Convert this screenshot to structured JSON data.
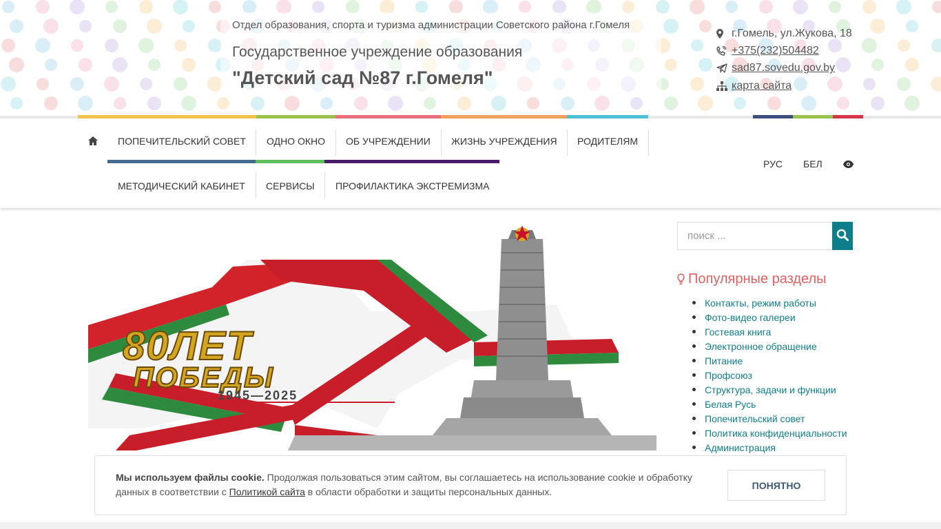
{
  "header": {
    "org_line": "Отдел образования, спорта и туризма администрации Советского района г.Гомеля",
    "institution_type": "Государственное учреждение образования",
    "institution_name": "\"Детский сад №87 г.Гомеля\"",
    "contacts": {
      "address": "г.Гомель, ул.Жукова, 18",
      "phone": "+375(232)504482",
      "website": "sad87.sovedu.gov.by",
      "sitemap": "карта сайта"
    }
  },
  "nav": {
    "home_icon": "home-icon",
    "items": [
      "ПОПЕЧИТЕЛЬСКИЙ СОВЕТ",
      "ОДНО ОКНО",
      "ОБ УЧРЕЖДЕНИИ",
      "ЖИЗНЬ УЧРЕЖДЕНИЯ",
      "РОДИТЕЛЯМ",
      "МЕТОДИЧЕСКИЙ КАБИНЕТ",
      "СЕРВИСЫ",
      "ПРОФИЛАКТИКА ЭКСТРЕМИЗМА"
    ],
    "lang_ru": "РУС",
    "lang_be": "БЕЛ",
    "accessibility_icon": "eye-icon"
  },
  "banner": {
    "line1": "80ЛЕТ",
    "line2": "ПОБЕДЫ",
    "years": "1945—2025"
  },
  "sidebar": {
    "search_placeholder": "поиск ...",
    "popular_title": "Популярные разделы",
    "popular_links": [
      "Контакты, режим работы",
      "Фото-видео галереи",
      "Гостевая книга",
      "Электронное обращение",
      "Питание",
      "Профсоюз",
      "Структура, задачи и функции",
      "Белая Русь",
      "Попечительский совет",
      "Политика конфиденциальности",
      "Администрация"
    ]
  },
  "cookie": {
    "bold": "Мы используем файлы cookie.",
    "text1": " Продолжая пользоваться этим сайтом, вы соглашаетесь на использование cookie и обработку данных в соответствии с ",
    "link": "Политикой сайта",
    "text2": " в области обработки и защиты персональных данных.",
    "button": "ПОНЯТНО"
  },
  "colors": {
    "accent": "#0e7e8a",
    "popular_title": "#e06060",
    "stripe_yellow": "#f4c44a",
    "stripe_green": "#9bc24d",
    "stripe_pink": "#ee6f7e",
    "stripe_orange": "#f0a15b",
    "stripe_cyan": "#4fc1d6",
    "stripe_navy": "#3c4f7c",
    "stripe_red": "#d6364a",
    "nav_under_blue": "#456b8f",
    "nav_under_green": "#5cbf5a",
    "nav_under_purple": "#4a1a6b"
  }
}
